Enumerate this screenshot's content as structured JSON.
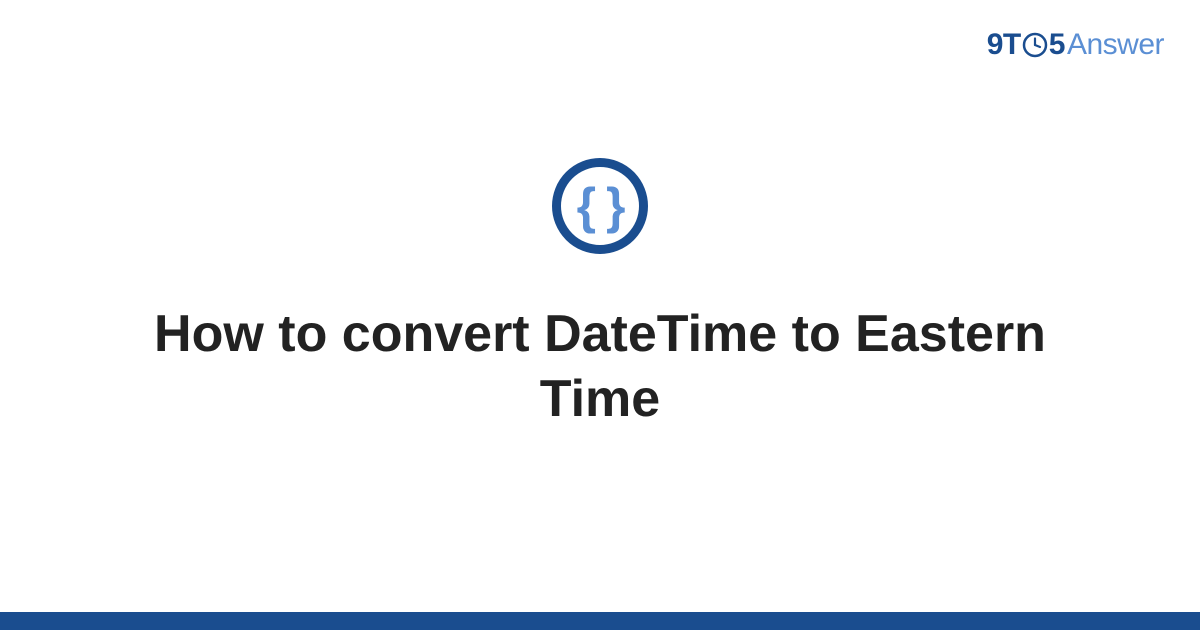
{
  "brand": {
    "prefix": "9T",
    "middle": "5",
    "suffix": "Answer"
  },
  "icon": {
    "glyph": "{ }"
  },
  "title": "How to convert DateTime to Eastern Time",
  "colors": {
    "accent_dark": "#1a4d8f",
    "accent_light": "#5b8fd4",
    "text": "#222222",
    "background": "#ffffff"
  }
}
